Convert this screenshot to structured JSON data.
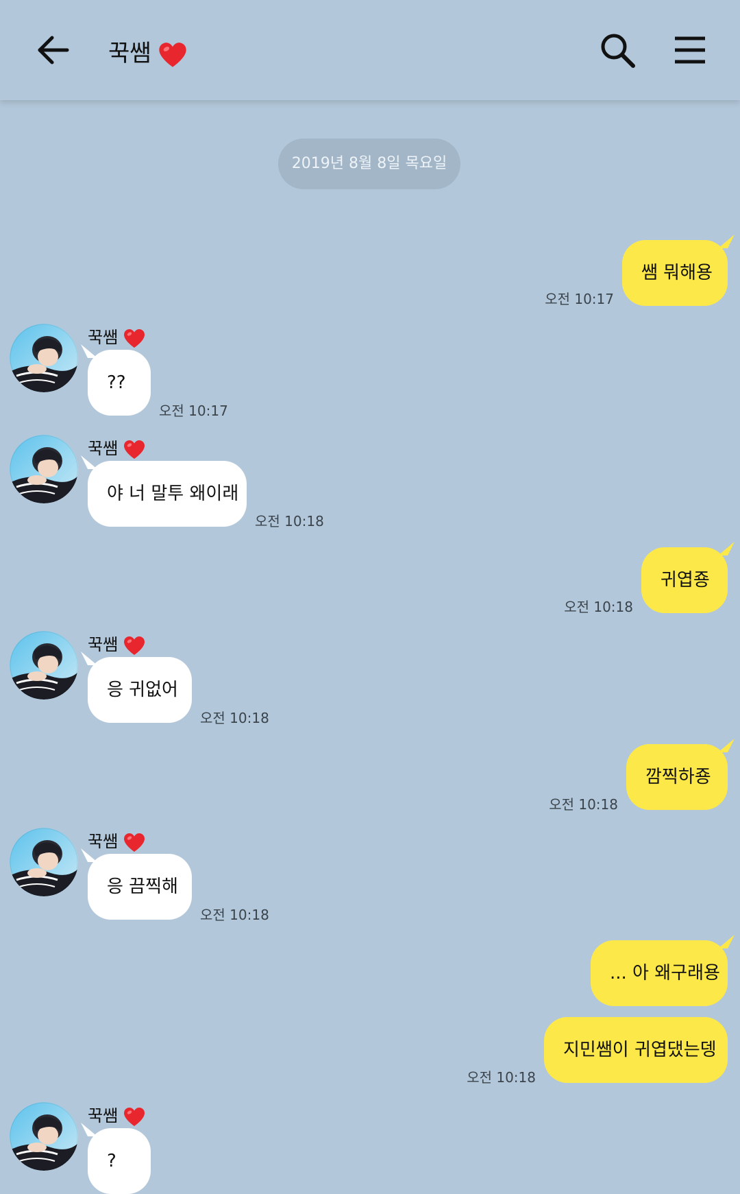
{
  "header": {
    "title": "꾹쌤",
    "title_icon": "red-heart-icon",
    "back_icon": "arrow-left-icon",
    "search_icon": "search-icon",
    "menu_icon": "hamburger-menu-icon"
  },
  "date_divider": "2019년 8월 8일 목요일",
  "contact": {
    "name": "꾹쌤",
    "name_icon": "red-heart-icon"
  },
  "colors": {
    "background": "#b2c7da",
    "my_bubble": "#fde84a",
    "their_bubble": "#ffffff",
    "heart": "#e8262e"
  },
  "messages": [
    {
      "from": "me",
      "text": "쌤 뭐해용",
      "time": "오전 10:17"
    },
    {
      "from": "them",
      "text": "??",
      "time": "오전 10:17"
    },
    {
      "from": "them",
      "text": "야 너 말투 왜이래",
      "time": "오전 10:18"
    },
    {
      "from": "me",
      "text": "귀엽죵",
      "time": "오전 10:18"
    },
    {
      "from": "them",
      "text": "응 귀없어",
      "time": "오전 10:18"
    },
    {
      "from": "me",
      "text": "깜찍하죵",
      "time": "오전 10:18"
    },
    {
      "from": "them",
      "text": "응 끔찍해",
      "time": "오전 10:18"
    },
    {
      "from": "me",
      "text": "... 아 왜구래용",
      "time": ""
    },
    {
      "from": "me",
      "text": "지민쌤이 귀엽댔는뎅",
      "time": "오전 10:18"
    },
    {
      "from": "them",
      "text": "?",
      "time": ""
    }
  ]
}
